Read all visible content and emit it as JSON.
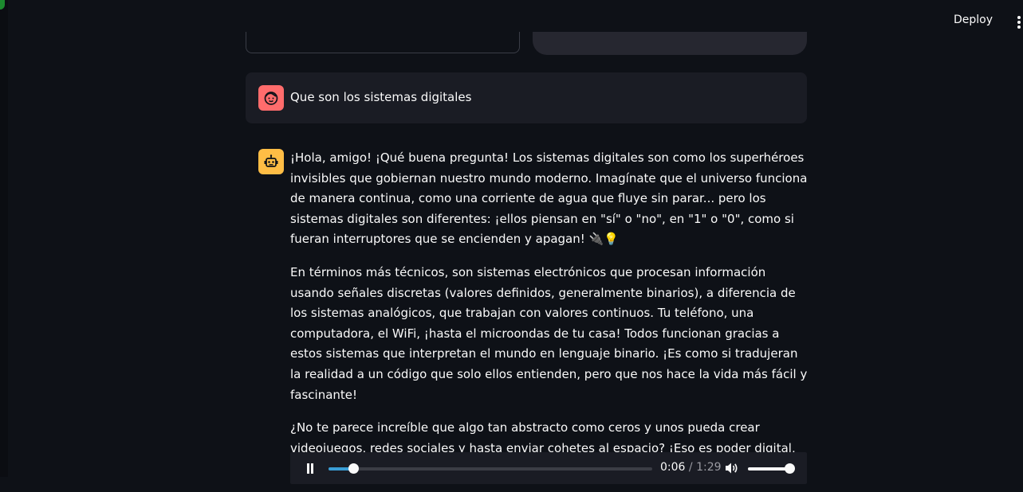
{
  "header": {
    "deploy_label": "Deploy",
    "menu_icon": "kebab-menu-icon"
  },
  "user_message": {
    "avatar_icon": "user-face-icon",
    "text": "Que son los sistemas digitales"
  },
  "assistant_message": {
    "avatar_icon": "robot-icon",
    "paragraphs": [
      "¡Hola, amigo! ¡Qué buena pregunta! Los sistemas digitales son como los superhéroes invisibles que gobiernan nuestro mundo moderno. Imagínate que el universo funciona de manera continua, como una corriente de agua que fluye sin parar... pero los sistemas digitales son diferentes: ¡ellos piensan en \"sí\" o \"no\", en \"1\" o \"0\", como si fueran interruptores que se encienden y apagan! 🔌💡",
      "En términos más técnicos, son sistemas electrónicos que procesan información usando señales discretas (valores definidos, generalmente binarios), a diferencia de los sistemas analógicos, que trabajan con valores continuos. Tu teléfono, una computadora, el WiFi, ¡hasta el microondas de tu casa! Todos funcionan gracias a estos sistemas que interpretan el mundo en lenguaje binario. ¡Es como si tradujeran la realidad a un código que solo ellos entienden, pero que nos hace la vida más fácil y fascinante!",
      "¿No te parece increíble que algo tan abstracto como ceros y unos pueda crear videojuegos, redes sociales y hasta enviar cohetes al espacio? ¡Eso es poder digital, amigo! science bitch 🚀"
    ]
  },
  "audio_player": {
    "current_time": "0:06",
    "separator": "/",
    "duration": "1:29",
    "progress_fraction": 0.077,
    "volume_fraction": 1.0,
    "play_state_icon": "pause-icon",
    "volume_icon": "volume-icon"
  },
  "colors": {
    "background": "#0e1117",
    "user_avatar": "#ff6c6c",
    "bot_avatar": "#ffbd45",
    "progress_accent": "#3a9ed6"
  }
}
